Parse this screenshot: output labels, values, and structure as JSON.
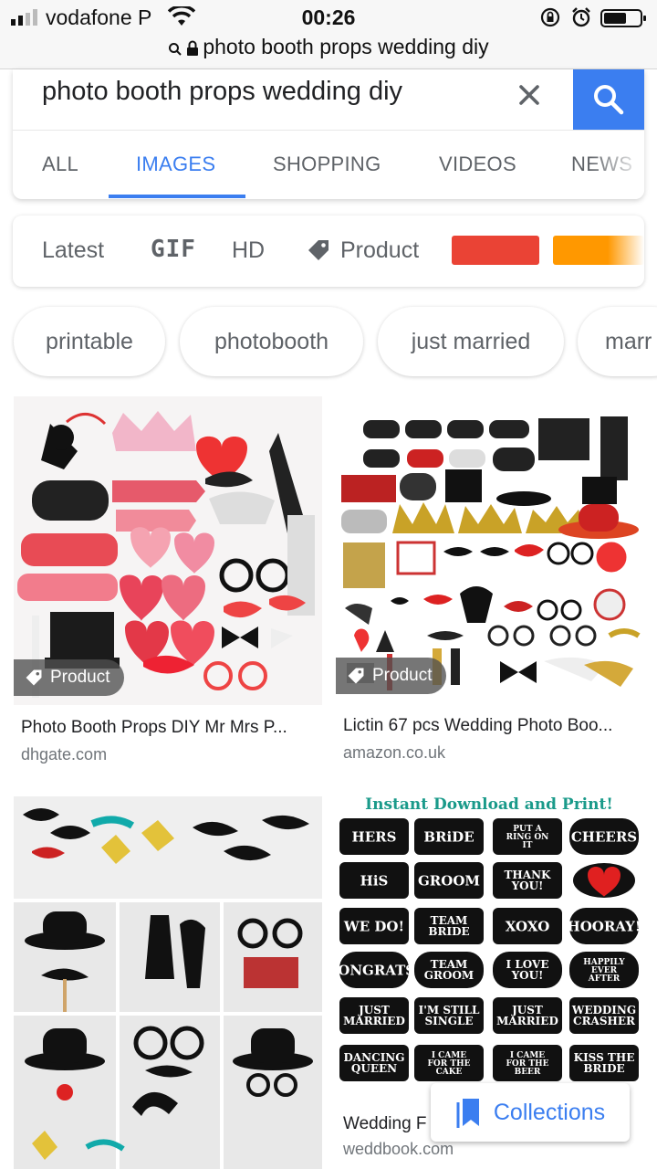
{
  "status_bar": {
    "carrier": "vodafone P",
    "time": "00:26",
    "url": "photo booth props wedding diy"
  },
  "search": {
    "query": "photo booth props wedding diy",
    "clear_icon": "close-icon",
    "search_icon": "search-icon",
    "accent": "#3b7ef0"
  },
  "tabs": [
    "ALL",
    "IMAGES",
    "SHOPPING",
    "VIDEOS",
    "NEWS"
  ],
  "active_tab": "IMAGES",
  "filters": {
    "latest": "Latest",
    "gif": "GIF",
    "hd": "HD",
    "product": "Product",
    "colors": [
      "#ea4335",
      "#ff9800"
    ]
  },
  "chips": [
    "printable",
    "photobooth",
    "just married",
    "marr"
  ],
  "results": [
    {
      "badge": "Product",
      "title": "Photo Booth Props DIY Mr Mrs P...",
      "source": "dhgate.com"
    },
    {
      "badge": "Product",
      "title": "Lictin 67 pcs Wedding Photo Boo...",
      "source": "amazon.co.uk"
    },
    {
      "title": "",
      "source": ""
    },
    {
      "header": "Instant Download and Print!",
      "labels": [
        "HERS",
        "BRiDE",
        "PUT A RING ON IT",
        "CHEERS",
        "HiS",
        "GROOM",
        "THANK YOU!",
        "WE DO!",
        "TEAM BRIDE",
        "XOXO",
        "HOORAY!",
        "CONGRATS!",
        "TEAM GROOM",
        "I LOVE YOU!",
        "HAPPILY EVER AFTER",
        "JUST MARRIED",
        "I'M STILL SINGLE",
        "JUST MARRIED",
        "WEDDING CRASHER",
        "DANCING QUEEN",
        "I CAME FOR THE CAKE",
        "I CAME FOR THE BEER",
        "KISS THE BRIDE"
      ],
      "title": "Wedding F",
      "source": "weddbook.com"
    }
  ],
  "collections_label": "Collections"
}
